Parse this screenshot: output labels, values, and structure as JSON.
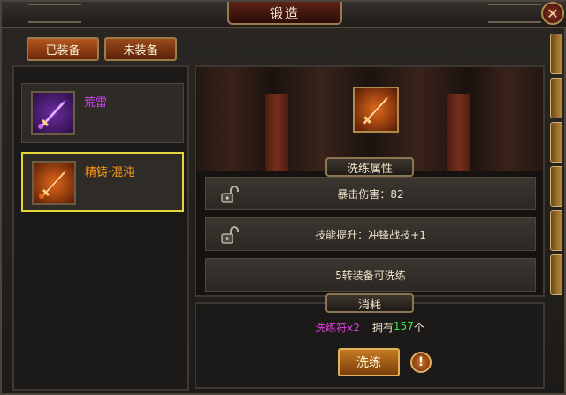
{
  "window": {
    "title": "锻造"
  },
  "tabs": [
    {
      "label": "已装备"
    },
    {
      "label": "未装备"
    }
  ],
  "items": [
    {
      "name": "荒雷",
      "name_color": "#d040f0",
      "icon": "purple-sword-icon"
    },
    {
      "name": "精铸·混沌",
      "name_color": "#ff9a1a",
      "icon": "orange-sword-icon"
    }
  ],
  "attributes": {
    "section_label": "洗练属性",
    "rows": [
      {
        "text": "暴击伤害：82",
        "lock_icon": "unlock-icon"
      },
      {
        "text": "技能提升：冲锋战技+1",
        "lock_icon": "unlock-icon"
      },
      {
        "text": "5转装备可洗练"
      }
    ]
  },
  "cost": {
    "section_label": "消耗",
    "item_name": "洗练符x2",
    "item_color": "#e040e0",
    "own_prefix": "拥有",
    "own_count": "157",
    "own_count_color": "#3ee04a",
    "own_suffix": "个"
  },
  "actions": {
    "wash_label": "洗练",
    "warn_icon": "exclamation-icon",
    "warn_glyph": "!"
  },
  "close_glyph": "✕"
}
